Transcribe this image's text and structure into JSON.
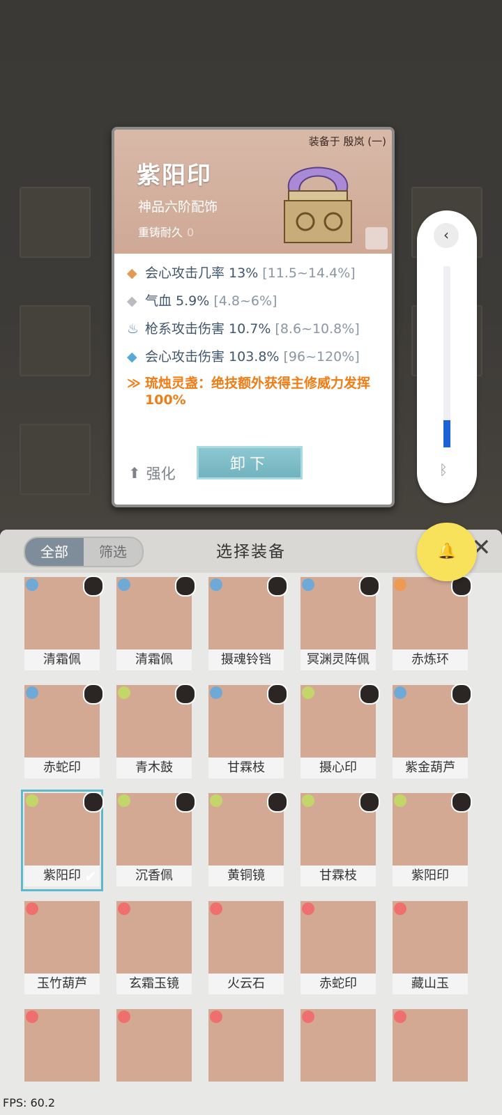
{
  "detail": {
    "equipped_to": "装备于 殷岚 (一)",
    "name": "紫阳印",
    "grade": "神品六阶配饰",
    "durability_label": "重铸耐久",
    "durability_value": "0",
    "stats": [
      {
        "bullet": "◆",
        "bullet_color": "#e39a54",
        "text": "会心攻击几率 13%",
        "range": "[11.5~14.4%]"
      },
      {
        "bullet": "◆",
        "bullet_color": "#b9bcc0",
        "text": "气血 5.9%",
        "range": "[4.8~6%]"
      },
      {
        "bullet": "♨",
        "bullet_color": "#4a7cc2",
        "text": "枪系攻击伤害 10.7%",
        "range": "[8.6~10.8%]"
      },
      {
        "bullet": "◆",
        "bullet_color": "#57a9d8",
        "text": "会心攻击伤害 103.8%",
        "range": "[96~120%]"
      }
    ],
    "special": {
      "bullet": "≫",
      "text": "琉烛灵盏：绝技额外获得主修威力发挥100%"
    },
    "enhance_label": "强化",
    "unequip_label": "卸下"
  },
  "side_panel": {
    "back_icon": "‹",
    "bt_icon": "ᛒ",
    "level": 0.15
  },
  "sheet": {
    "tabs": [
      {
        "label": "全部",
        "active": true
      },
      {
        "label": "筛选",
        "active": false
      }
    ],
    "title": "选择装备",
    "close": "✕"
  },
  "items": [
    {
      "name": "清霜佩",
      "elem": "#6fa9d6"
    },
    {
      "name": "清霜佩",
      "elem": "#6fa9d6"
    },
    {
      "name": "摄魂铃铛",
      "elem": "#6fa9d6"
    },
    {
      "name": "冥渊灵阵佩",
      "elem": "#6fa9d6"
    },
    {
      "name": "赤炼环",
      "elem": "#ef9a52"
    },
    {
      "name": "赤蛇印",
      "elem": "#6fa9d6"
    },
    {
      "name": "青木鼓",
      "elem": "#c4d56a"
    },
    {
      "name": "甘霖枝",
      "elem": "#6fa9d6"
    },
    {
      "name": "摄心印",
      "elem": "#c4d56a"
    },
    {
      "name": "紫金葫芦",
      "elem": "#6fa9d6"
    },
    {
      "name": "紫阳印",
      "elem": "#c4d56a",
      "selected": true
    },
    {
      "name": "沉香佩",
      "elem": "#c4d56a"
    },
    {
      "name": "黄铜镜",
      "elem": "#c4d56a"
    },
    {
      "name": "甘霖枝",
      "elem": "#c4d56a"
    },
    {
      "name": "紫阳印",
      "elem": "#c4d56a"
    },
    {
      "name": "玉竹葫芦",
      "elem": "#ef6f6f"
    },
    {
      "name": "玄霜玉镜",
      "elem": "#ef6f6f"
    },
    {
      "name": "火云石",
      "elem": "#ef6f6f"
    },
    {
      "name": "赤蛇印",
      "elem": "#ef6f6f"
    },
    {
      "name": "藏山玉",
      "elem": "#ef6f6f"
    },
    {
      "name": "",
      "elem": "#ef6f6f"
    },
    {
      "name": "",
      "elem": "#ef6f6f"
    },
    {
      "name": "",
      "elem": "#ef6f6f"
    },
    {
      "name": "",
      "elem": "#ef6f6f"
    },
    {
      "name": "",
      "elem": "#ef6f6f"
    }
  ],
  "bell_icon": "🔔",
  "fps": "FPS: 60.2"
}
